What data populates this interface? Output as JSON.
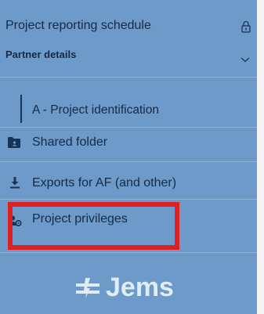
{
  "sidebar": {
    "schedule_label": "Project reporting schedule",
    "partner_label": "Partner details",
    "items": [
      {
        "label": "A - Project identification"
      },
      {
        "label": "Shared folder",
        "icon": "folder-icon"
      },
      {
        "label": "Exports for AF (and other)",
        "icon": "download-icon"
      },
      {
        "label": "Project privileges",
        "icon": "user-gear-icon"
      }
    ]
  },
  "logo": {
    "text": "Jems"
  },
  "colors": {
    "sidebar_bg": "#6d9ac9",
    "text": "#142a48",
    "highlight": "#e02020",
    "logo": "#e2ecf6"
  }
}
